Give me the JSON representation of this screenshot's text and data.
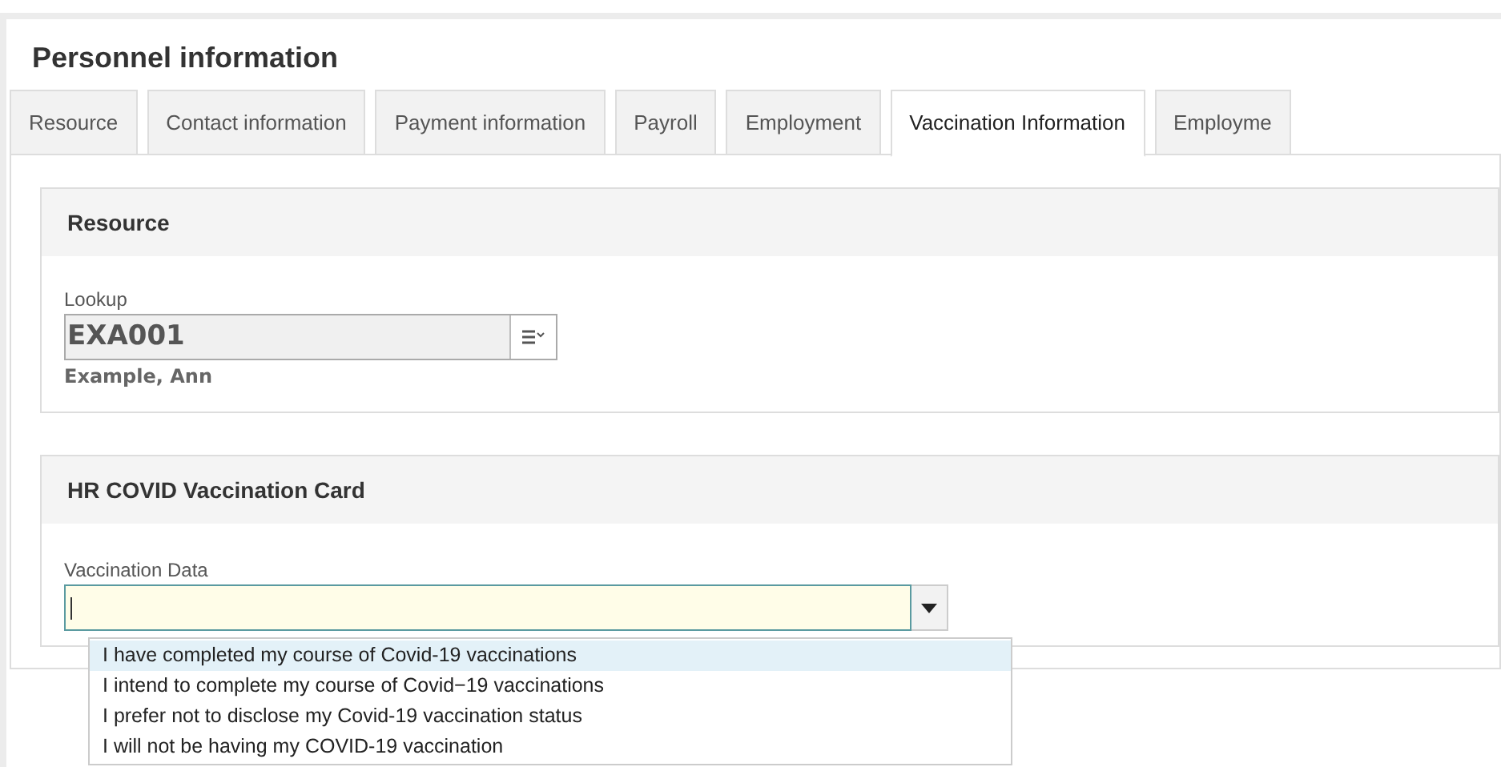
{
  "page_title": "Personnel information",
  "tabs": [
    {
      "label": "Resource",
      "selected": false
    },
    {
      "label": "Contact information",
      "selected": false
    },
    {
      "label": "Payment information",
      "selected": false
    },
    {
      "label": "Payroll",
      "selected": false
    },
    {
      "label": "Employment",
      "selected": false
    },
    {
      "label": "Vaccination Information",
      "selected": true
    },
    {
      "label": "Employme",
      "selected": false
    }
  ],
  "resource_section": {
    "title": "Resource",
    "lookup": {
      "label": "Lookup",
      "value": "EXA001",
      "description": "Example, Ann"
    }
  },
  "vaccination_section": {
    "title": "HR COVID Vaccination Card",
    "field": {
      "label": "Vaccination Data",
      "expanded": true,
      "options": [
        {
          "label": "I have completed my course of Covid-19 vaccinations",
          "selected": true
        },
        {
          "label": "I intend to complete my course of Covid−19 vaccinations",
          "selected": false
        },
        {
          "label": "I prefer not to disclose my Covid-19 vaccination status",
          "selected": false
        },
        {
          "label": "I will not be having my COVID-19 vaccination",
          "selected": false
        }
      ]
    }
  }
}
